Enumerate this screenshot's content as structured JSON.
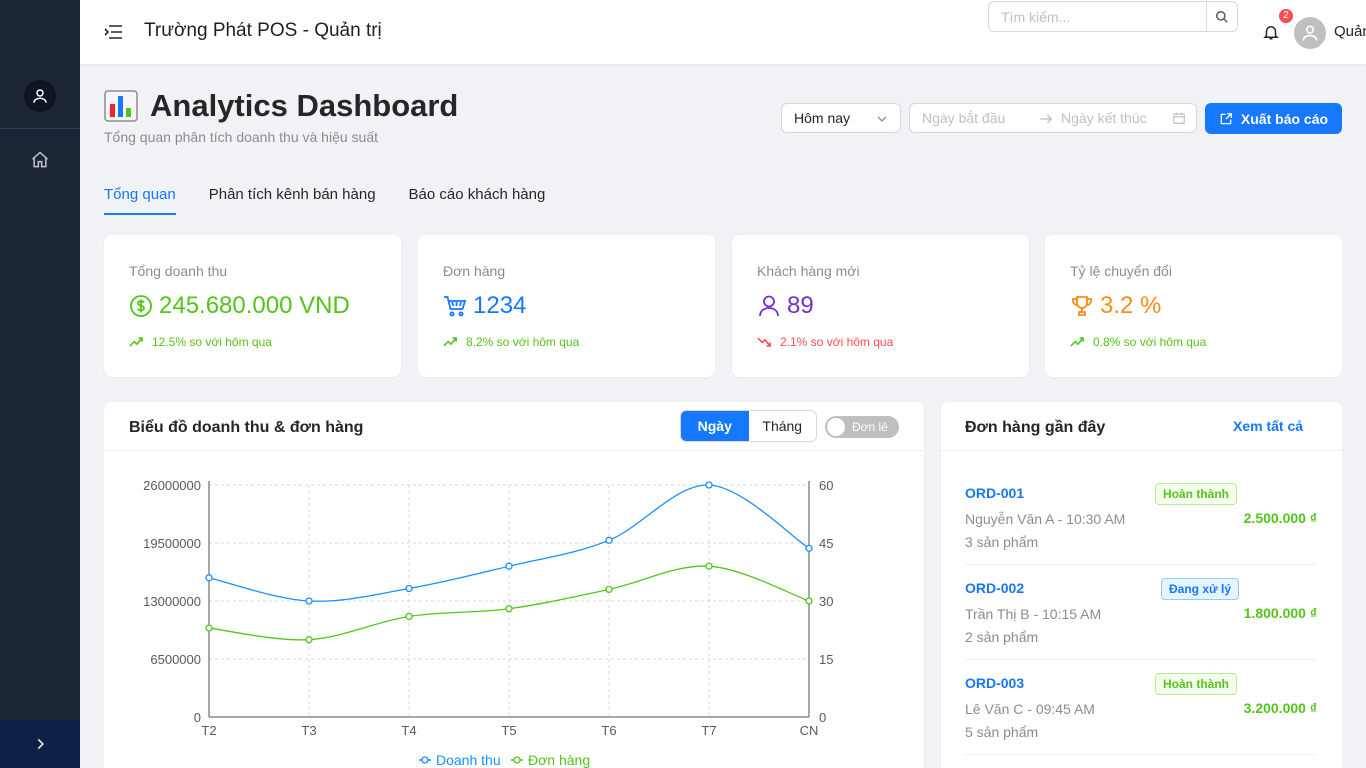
{
  "app": {
    "title": "Trường Phát POS - Quản trị"
  },
  "header": {
    "search_placeholder": "Tìm kiếm...",
    "notification_count": "2",
    "user_name": "Quản"
  },
  "page": {
    "title": "Analytics Dashboard",
    "subtitle": "Tổng quan phân tích doanh thu và hiệu suất",
    "period_select": "Hôm nay",
    "date_start_placeholder": "Ngày bắt đầu",
    "date_end_placeholder": "Ngày kết thúc",
    "export_label": "Xuất báo cáo"
  },
  "tabs": [
    {
      "label": "Tổng quan",
      "active": true
    },
    {
      "label": "Phân tích kênh bán hàng",
      "active": false
    },
    {
      "label": "Báo cáo khách hàng",
      "active": false
    }
  ],
  "stats": [
    {
      "label": "Tổng doanh thu",
      "value": "245.680.000 VND",
      "change": "12.5% so với hôm qua",
      "trend": "up",
      "color": "#52c41a",
      "icon": "dollar-circle-icon"
    },
    {
      "label": "Đơn hàng",
      "value": "1234",
      "change": "8.2% so với hôm qua",
      "trend": "up",
      "color": "#1677ff",
      "icon": "cart-icon"
    },
    {
      "label": "Khách hàng mới",
      "value": "89",
      "change": "2.1% so với hôm qua",
      "trend": "down",
      "color": "#722ed1",
      "icon": "user-icon"
    },
    {
      "label": "Tỷ lệ chuyển đổi",
      "value": "3.2 %",
      "change": "0.8% so với hôm qua",
      "trend": "up",
      "color": "#fa8c16",
      "icon": "trophy-icon"
    }
  ],
  "chart_panel": {
    "title": "Biểu đồ doanh thu & đơn hàng",
    "seg_day": "Ngày",
    "seg_month": "Tháng",
    "toggle_label": "Đơn lẻ"
  },
  "chart_data": {
    "type": "line",
    "categories": [
      "T2",
      "T3",
      "T4",
      "T5",
      "T6",
      "T7",
      "CN"
    ],
    "series": [
      {
        "name": "Doanh thu",
        "axis": "left",
        "color": "#1890ff",
        "values": [
          15600000,
          13000000,
          14400000,
          16900000,
          19800000,
          26000000,
          18900000
        ]
      },
      {
        "name": "Đơn hàng",
        "axis": "right",
        "color": "#52c41a",
        "values": [
          23,
          20,
          26,
          28,
          33,
          39,
          30
        ]
      }
    ],
    "y_left": {
      "min": 0,
      "max": 26000000,
      "ticks": [
        "0",
        "6500000",
        "13000000",
        "19500000",
        "26000000"
      ]
    },
    "y_right": {
      "min": 0,
      "max": 60,
      "ticks": [
        "0",
        "15",
        "30",
        "45",
        "60"
      ]
    },
    "grid": true,
    "legend": "bottom"
  },
  "orders_panel": {
    "title": "Đơn hàng gần đây",
    "see_all": "Xem tất cả",
    "orders": [
      {
        "id": "ORD-001",
        "customer": "Nguyễn Văn A - 10:30 AM",
        "items": "3 sản phẩm",
        "status": "Hoàn thành",
        "status_type": "done",
        "amount": "2.500.000 ₫"
      },
      {
        "id": "ORD-002",
        "customer": "Trần Thị B - 10:15 AM",
        "items": "2 sản phẩm",
        "status": "Đang xử lý",
        "status_type": "proc",
        "amount": "1.800.000 ₫"
      },
      {
        "id": "ORD-003",
        "customer": "Lê Văn C - 09:45 AM",
        "items": "5 sản phẩm",
        "status": "Hoàn thành",
        "status_type": "done",
        "amount": "3.200.000 ₫"
      }
    ]
  }
}
